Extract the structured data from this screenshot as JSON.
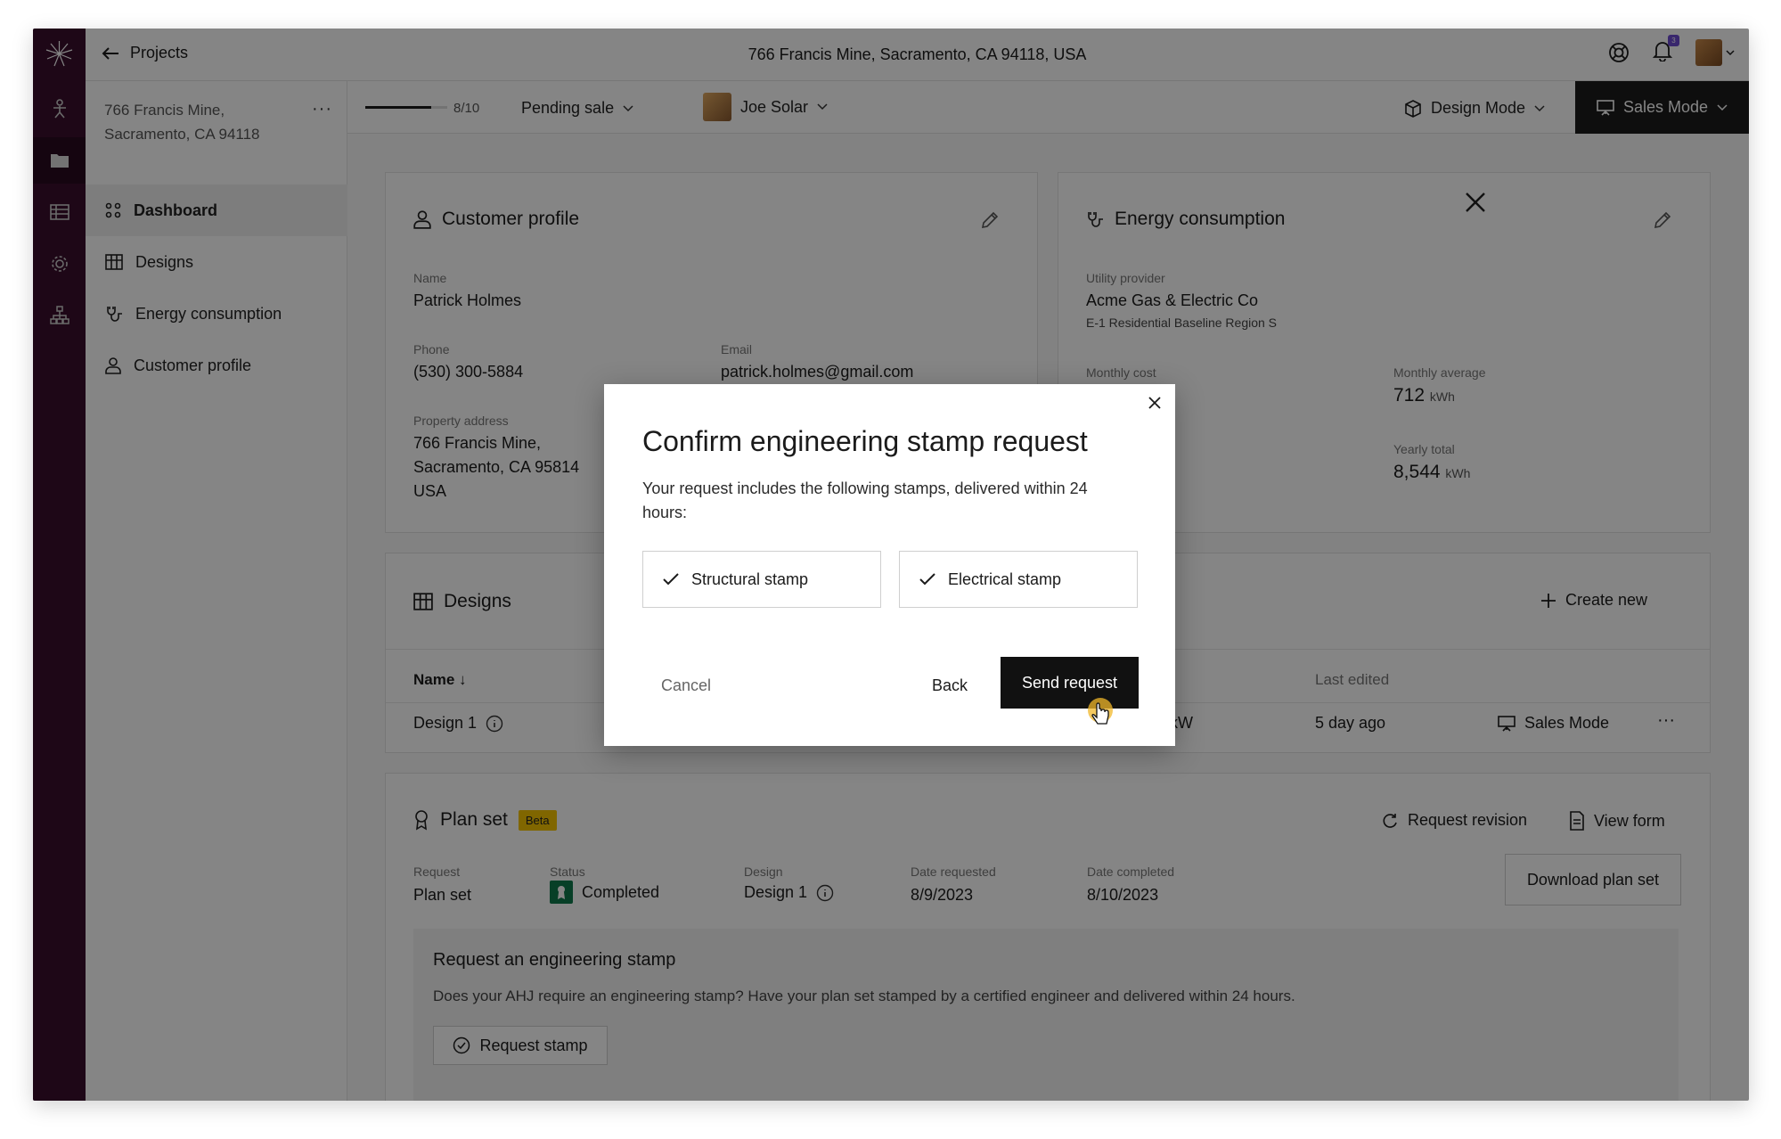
{
  "topbar": {
    "back_label": "Projects",
    "address": "766 Francis Mine, Sacramento, CA 94118, USA",
    "notification_count": "3"
  },
  "leftnav": {
    "project_address": "766 Francis Mine, Sacramento, CA 94118",
    "more": "···",
    "items": [
      {
        "label": "Dashboard"
      },
      {
        "label": "Designs"
      },
      {
        "label": "Energy consumption"
      },
      {
        "label": "Customer profile"
      }
    ]
  },
  "subbar": {
    "progress_text": "8/10",
    "progress_fraction": 0.8,
    "status": "Pending sale",
    "user": "Joe Solar",
    "design_mode": "Design Mode",
    "sales_mode": "Sales Mode"
  },
  "customer_profile": {
    "title": "Customer profile",
    "name_label": "Name",
    "name": "Patrick Holmes",
    "phone_label": "Phone",
    "phone": "(530) 300-5884",
    "email_label": "Email",
    "email": "patrick.holmes@gmail.com",
    "address_label": "Property address",
    "address_line1": "766 Francis Mine,",
    "address_line2": "Sacramento, CA 95814",
    "address_line3": "USA"
  },
  "energy": {
    "title": "Energy consumption",
    "provider_label": "Utility provider",
    "provider": "Acme Gas & Electric Co",
    "rate_plan": "E-1 Residential Baseline Region S",
    "monthly_cost_label": "Monthly cost",
    "monthly_avg_label": "Monthly average",
    "monthly_avg": "712",
    "unit": "kWh",
    "yearly_total_label": "Yearly total",
    "yearly_total": "8,544"
  },
  "designs": {
    "title": "Designs",
    "create_new": "Create new",
    "col_name": "Name ↓",
    "col_last_edited": "Last edited",
    "row": {
      "name": "Design 1",
      "kw": "kW",
      "last_edited": "5 day ago",
      "mode": "Sales Mode",
      "more": "···"
    }
  },
  "plan_set": {
    "title": "Plan set",
    "badge": "Beta",
    "request_revision": "Request revision",
    "view_form": "View form",
    "download": "Download plan set",
    "request_label": "Request",
    "request": "Plan set",
    "status_label": "Status",
    "status": "Completed",
    "design_label": "Design",
    "design": "Design 1",
    "date_requested_label": "Date requested",
    "date_requested": "8/9/2023",
    "date_completed_label": "Date completed",
    "date_completed": "8/10/2023"
  },
  "stamp_section": {
    "title": "Request an engineering stamp",
    "description": "Does your AHJ require an engineering stamp? Have your plan set stamped by a certified engineer and delivered within 24 hours.",
    "button": "Request stamp"
  },
  "modal": {
    "title": "Confirm engineering stamp request",
    "body": "Your request includes the following stamps, delivered within 24 hours:",
    "option1": "Structural stamp",
    "option2": "Electrical stamp",
    "cancel": "Cancel",
    "back": "Back",
    "send": "Send request"
  },
  "colors": {
    "rail": "#3a0f2c",
    "primary_button": "#111111",
    "beta_badge": "#f5c400",
    "status_completed": "#0f7a4b"
  }
}
